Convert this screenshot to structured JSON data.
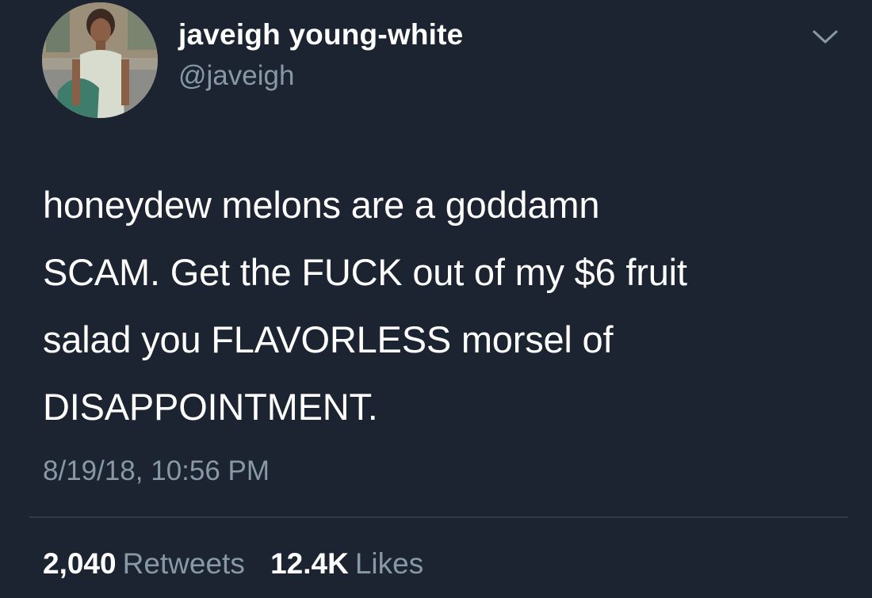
{
  "author": {
    "name": "javeigh young-white",
    "handle": "@javeigh"
  },
  "tweet": {
    "text": "honeydew melons are a goddamn\nSCAM. Get the FUCK out of my $6 fruit\nsalad you FLAVORLESS morsel of\nDISAPPOINTMENT.",
    "timestamp": "8/19/18, 10:56 PM"
  },
  "stats": {
    "retweets_count": "2,040",
    "retweets_label": "Retweets",
    "likes_count": "12.4K",
    "likes_label": "Likes"
  },
  "icons": {
    "menu": "chevron-down-icon"
  },
  "colors": {
    "background": "#1b2430",
    "primary_text": "#ffffff",
    "secondary_text": "#8899a6",
    "divider": "#2f3b48"
  }
}
